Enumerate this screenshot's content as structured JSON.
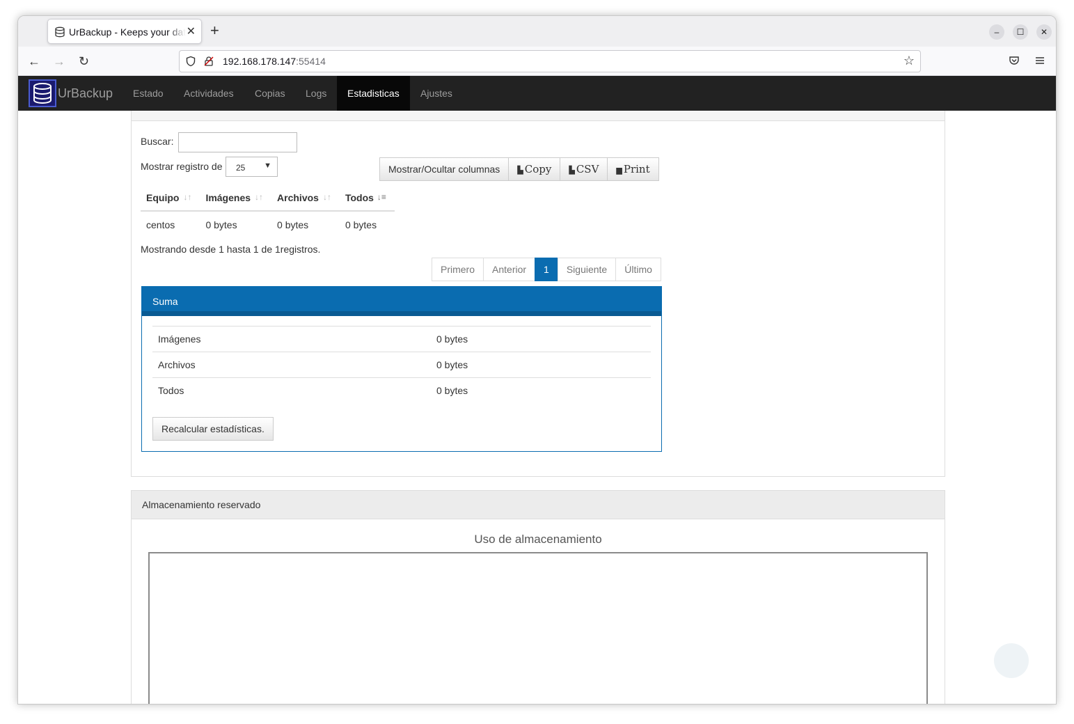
{
  "browser": {
    "tab_title": "UrBackup - Keeps your data safe",
    "url_host": "192.168.178.147",
    "url_port": ":55414",
    "tab_close": "✕",
    "new_tab": "+",
    "nav_back": "←",
    "nav_forward": "→",
    "nav_reload": "↻",
    "star": "☆",
    "minimize": "–",
    "maximize": "☐",
    "close": "✕"
  },
  "app": {
    "brand": "UrBackup",
    "menu": [
      "Estado",
      "Actividades",
      "Copias",
      "Logs",
      "Estadisticas",
      "Ajustes"
    ],
    "active_menu": "Estadisticas"
  },
  "stats": {
    "search_label": "Buscar:",
    "search_value": "",
    "length_label": "Mostrar registro de",
    "length_value": "25",
    "buttons": {
      "colvis": "Mostrar/Ocultar columnas",
      "copy": "Copy",
      "csv": "CSV",
      "print": "Print"
    },
    "columns": [
      "Equipo",
      "Imágenes",
      "Archivos",
      "Todos"
    ],
    "rows": [
      [
        "centos",
        "0 bytes",
        "0 bytes",
        "0 bytes"
      ]
    ],
    "info": "Mostrando desde 1 hasta 1 de 1registros.",
    "pager": {
      "first": "Primero",
      "prev": "Anterior",
      "current": "1",
      "next": "Siguiente",
      "last": "Último"
    }
  },
  "suma": {
    "title": "Suma",
    "rows": [
      {
        "label": "Imágenes",
        "value": "0 bytes"
      },
      {
        "label": "Archivos",
        "value": "0 bytes"
      },
      {
        "label": "Todos",
        "value": "0 bytes"
      }
    ],
    "recalc_button": "Recalcular estadísticas."
  },
  "storage": {
    "panel_title": "Almacenamiento reservado",
    "chart_title": "Uso de almacenamiento"
  },
  "colors": {
    "navbar_bg": "#222222",
    "accent_blue": "#0a6cb0"
  }
}
